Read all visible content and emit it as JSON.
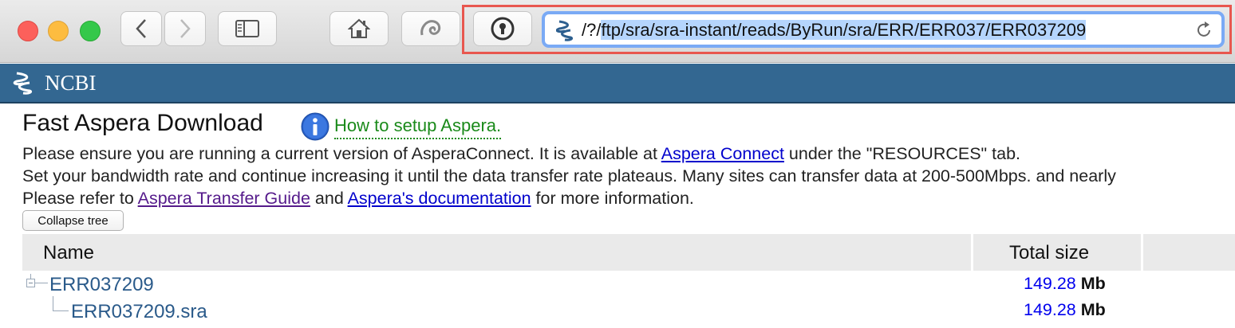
{
  "browser": {
    "url_prefix": "/?/",
    "url_selected": "ftp/sra/sra-instant/reads/ByRun/sra/ERR/ERR037/ERR037209"
  },
  "site": {
    "logo_text": "NCBI",
    "header_color": "#336791"
  },
  "page": {
    "title": "Fast Aspera Download",
    "howto_link": "How to setup Aspera.",
    "line1": {
      "before": "Please ensure you are running a current version of AsperaConnect. It is available at ",
      "link": "Aspera Connect",
      "after": " under the \"RESOURCES\" tab."
    },
    "line2": "Set your bandwidth rate and continue increasing it until the data transfer rate plateaus. Many sites can transfer data at 200-500Mbps. and nearly",
    "line3": {
      "before": "Please refer to ",
      "link1": "Aspera Transfer Guide",
      "middle": " and ",
      "link2": "Aspera's documentation",
      "after": " for more information."
    },
    "collapse_button": "Collapse tree"
  },
  "table": {
    "headers": {
      "name": "Name",
      "size": "Total size"
    },
    "rows": [
      {
        "name": "ERR037209",
        "size": "149.28",
        "unit": "Mb"
      },
      {
        "name": "ERR037209.sra",
        "size": "149.28",
        "unit": "Mb"
      }
    ]
  }
}
